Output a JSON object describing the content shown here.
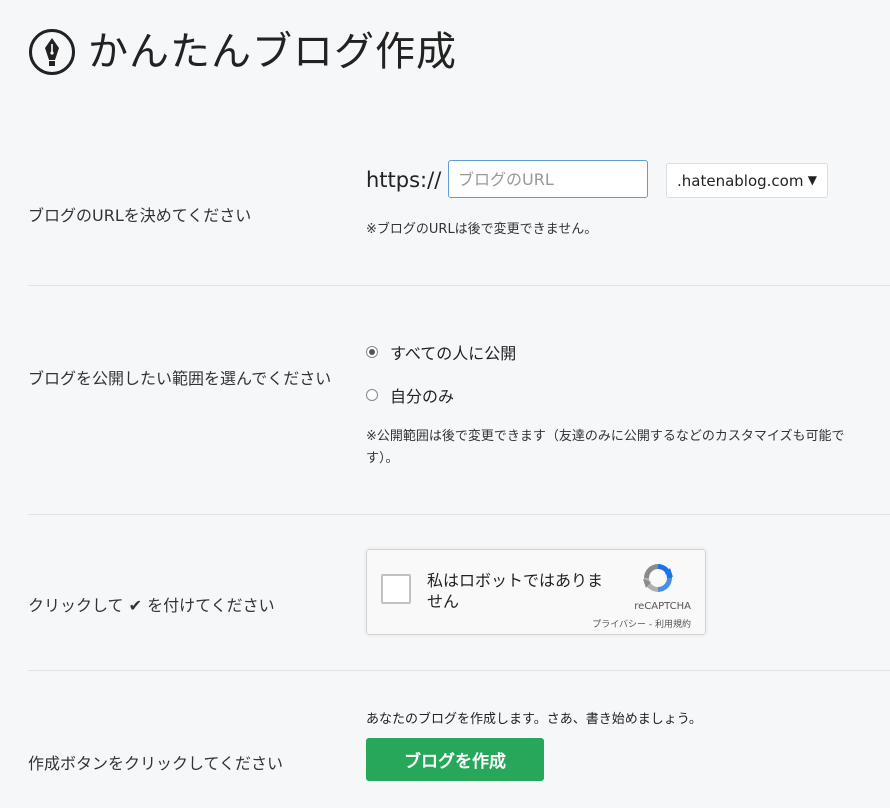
{
  "header": {
    "title": "かんたんブログ作成",
    "logo_icon": "pen-nib-icon"
  },
  "url_section": {
    "label": "ブログのURLを決めてください",
    "prefix": "https://",
    "input_placeholder": "ブログのURL",
    "input_value": "",
    "domain_selected": ".hatenablog.com",
    "note": "※ブログのURLは後で変更できません。"
  },
  "visibility_section": {
    "label": "ブログを公開したい範囲を選んでください",
    "options": [
      {
        "label": "すべての人に公開",
        "checked": true
      },
      {
        "label": "自分のみ",
        "checked": false
      }
    ],
    "note_line1": "※公開範囲は後で変更できます（友達のみに公開するなどのカスタマイズも可能で",
    "note_line2": "す）。"
  },
  "captcha_section": {
    "label_prefix": "クリックして",
    "label_check": "✔",
    "label_suffix": "を付けてください",
    "captcha_text": "私はロボットではありません",
    "brand": "reCAPTCHA",
    "links": "プライバシー - 利用規約"
  },
  "create_section": {
    "label": "作成ボタンをクリックしてください",
    "note": "あなたのブログを作成します。さあ、書き始めましょう。",
    "button_label": "ブログを作成"
  },
  "colors": {
    "accent_green": "#27a75a",
    "input_focus_blue": "#5b9dd9",
    "background": "#f6f7f9"
  }
}
